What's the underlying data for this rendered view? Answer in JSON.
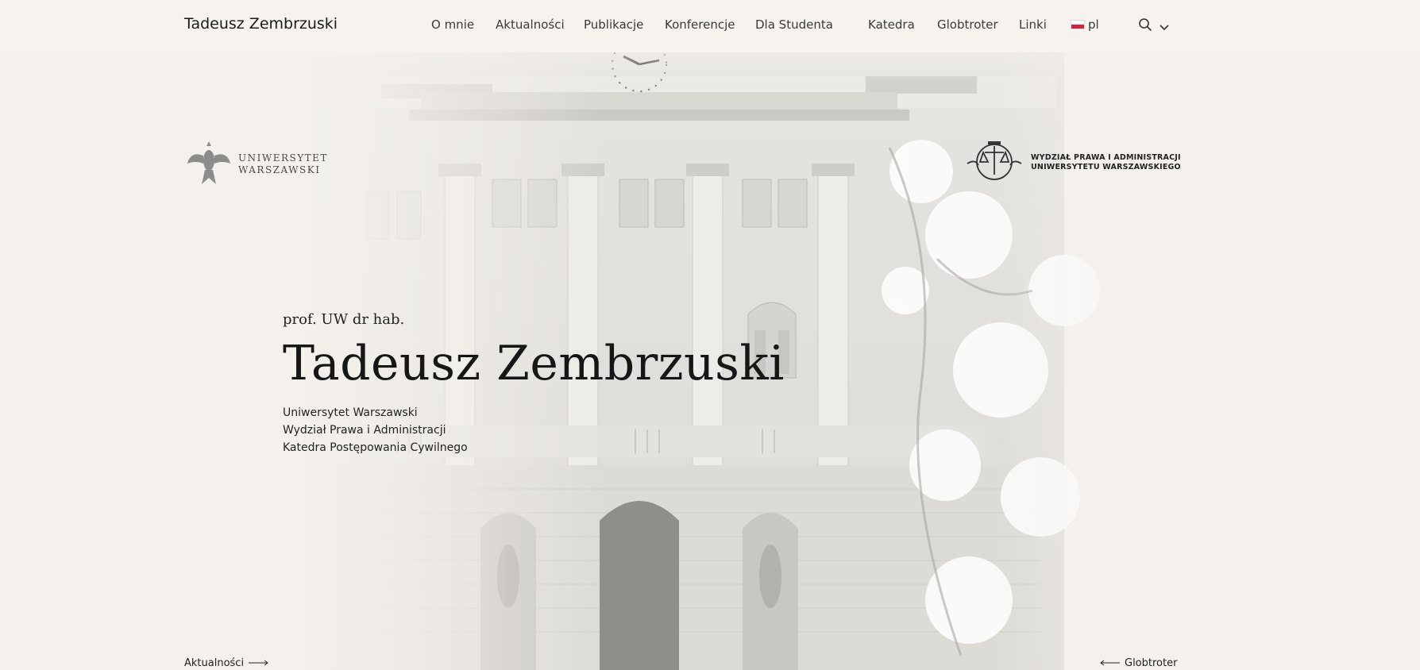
{
  "header": {
    "site_title": "Tadeusz Zembrzuski",
    "nav": [
      {
        "label": "O mnie"
      },
      {
        "label": "Aktualności"
      },
      {
        "label": "Publikacje"
      },
      {
        "label": "Konferencje"
      },
      {
        "label": "Dla Studenta"
      },
      {
        "label": "Katedra"
      },
      {
        "label": "Globtroter"
      },
      {
        "label": "Linki"
      }
    ],
    "language": "pl",
    "icons": {
      "search": "search-icon",
      "chevron": "chevron-down-icon",
      "flag": "poland-flag-icon"
    }
  },
  "hero": {
    "logo_left": {
      "line1": "UNIWERSYTET",
      "line2": "WARSZAWSKI",
      "icon": "eagle-emblem-icon"
    },
    "logo_right": {
      "line1": "WYDZIAŁ PRAWA I ADMINISTRACJI",
      "line2": "UNIWERSYTETU WARSZAWSKIEGO",
      "icon": "scales-emblem-icon"
    },
    "subtitle": "prof. UW dr hab.",
    "name": "Tadeusz Zembrzuski",
    "affiliation": [
      "Uniwersytet Warszawski",
      "Wydział Prawa i Administracji",
      "Katedra Postępowania Cywilnego"
    ],
    "prev_link": "Aktualności",
    "next_link": "Globtroter"
  },
  "colors": {
    "background": "#f4f1ec",
    "text": "#1d1d1d",
    "flag_red": "#d4213d"
  }
}
